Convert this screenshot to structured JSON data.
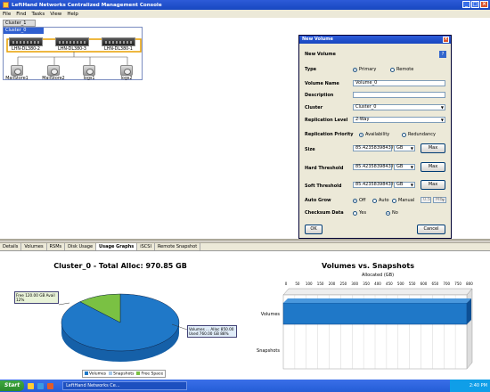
{
  "window": {
    "title": "LeftHand Networks Centralized Management Console"
  },
  "menu": [
    "File",
    "Find",
    "Tasks",
    "View",
    "Help"
  ],
  "topology": {
    "tab_label": "Cluster_1",
    "cluster_label": "Cluster_0",
    "servers": [
      "LHN-DL380-2",
      "LHN-DL380-3",
      "LHN-DL380-1"
    ],
    "volumes": [
      "MailStore1",
      "MailStore2",
      "logs1",
      "logs2"
    ]
  },
  "dialog": {
    "title": "New Volume",
    "heading": "New Volume",
    "help": "?",
    "type_label": "Type",
    "type_options": [
      "Primary",
      "Remote"
    ],
    "volume_name_label": "Volume Name",
    "volume_name_value": "Volume_0",
    "description_label": "Description",
    "cluster_label": "Cluster",
    "cluster_value": "Cluster_0",
    "replication_level_label": "Replication Level",
    "replication_level_value": "2-Way",
    "replication_priority_label": "Replication Priority",
    "replication_priority_options": [
      "Availability",
      "Redundancy"
    ],
    "size_label": "Size",
    "size_value": "85.423583984375",
    "size_unit": "GB",
    "hard_threshold_label": "Hard Threshold",
    "hard_threshold_value": "85.423583984375",
    "hard_threshold_unit": "GB",
    "soft_threshold_label": "Soft Threshold",
    "soft_threshold_value": "85.423583984375",
    "soft_threshold_unit": "GB",
    "max_label": "Max",
    "auto_grow_label": "Auto Grow",
    "auto_grow_options": [
      "Off",
      "Auto",
      "Manual"
    ],
    "auto_grow_manual_value": "0.5",
    "auto_grow_manual_unit": "MB",
    "checksum_label": "Checksum Data",
    "checksum_options": [
      "Yes",
      "No"
    ],
    "ok_label": "OK",
    "cancel_label": "Cancel"
  },
  "tabs": [
    "Details",
    "Volumes",
    "RSMs",
    "Disk Usage",
    "Usage Graphs",
    "iSCSI",
    "Remote Snapshot"
  ],
  "active_tab": "Usage Graphs",
  "pie": {
    "title": "Cluster_0 - Total Alloc: 970.85 GB",
    "callout_green_1": "Free 120.00 GB Avail",
    "callout_green_2": "12%",
    "callout_blue_1": "Volumes ... Alloc 850.00",
    "callout_blue_2": "Used 760.00 GB 88%",
    "legend": [
      "Volumes",
      "Snapshots",
      "Free Space"
    ],
    "colors": {
      "volumes": "#1f78c8",
      "snapshots": "#a8c8e8",
      "free": "#7ac143"
    }
  },
  "bar": {
    "title": "Volumes vs. Snapshots",
    "axis_title": "Allocated (GB)",
    "ticks": [
      "0",
      "50",
      "100",
      "150",
      "200",
      "250",
      "300",
      "350",
      "400",
      "450",
      "500",
      "550",
      "600",
      "650",
      "700",
      "750",
      "800"
    ],
    "categories": [
      "Volumes",
      "Snapshots"
    ]
  },
  "chart_data": [
    {
      "type": "pie",
      "title": "Cluster_0 - Total Alloc: 970.85 GB",
      "categories": [
        "Volumes",
        "Free Space"
      ],
      "values": [
        88,
        12
      ]
    },
    {
      "type": "bar",
      "title": "Volumes vs. Snapshots",
      "xlabel": "Allocated (GB)",
      "categories": [
        "Volumes",
        "Snapshots"
      ],
      "values": [
        850,
        0
      ],
      "xlim": [
        0,
        800
      ]
    }
  ],
  "taskbar": {
    "start": "Start",
    "task": "LeftHand Networks Ce...",
    "clock": "2:40 PM"
  }
}
